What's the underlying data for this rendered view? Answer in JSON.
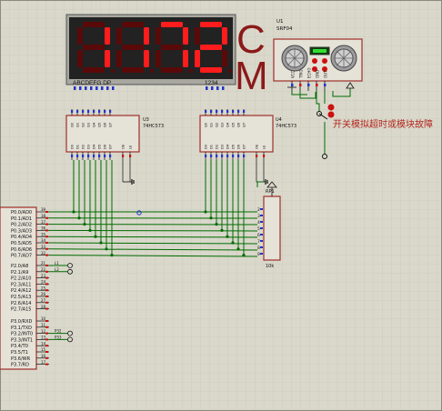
{
  "display": {
    "digits": [
      "1",
      "1",
      "7",
      "2"
    ],
    "seg_label": "ABCDEFG DP",
    "dig_label": "1234",
    "unit_top": "C",
    "unit_bottom": "M"
  },
  "ultrasonic": {
    "ref": "U1",
    "part": "SRF04",
    "pins": [
      "VCC",
      "TRIG",
      "ECHO",
      "GND",
      "OUT"
    ]
  },
  "latch_left": {
    "ref": "U3",
    "part": "74HC573",
    "top_pins": [
      "Q0",
      "Q1",
      "Q2",
      "Q3",
      "Q4",
      "Q5",
      "Q6",
      "Q7"
    ],
    "bottom_pins": [
      "D0",
      "D1",
      "D2",
      "D3",
      "D4",
      "D5",
      "D6",
      "D7"
    ],
    "side_pins": [
      "OE",
      "LE"
    ]
  },
  "latch_right": {
    "ref": "U4",
    "part": "74HC573",
    "top_pins": [
      "Q0",
      "Q1",
      "Q2",
      "Q3",
      "Q4",
      "Q5",
      "Q6",
      "Q7"
    ],
    "bottom_pins": [
      "D0",
      "D1",
      "D2",
      "D3",
      "D4",
      "D5",
      "D6",
      "D7"
    ],
    "side_pins": [
      "OE",
      "LE"
    ]
  },
  "resistor_pack": {
    "ref": "RP1",
    "value": "10k",
    "pins": [
      "2",
      "3",
      "4",
      "5",
      "6",
      "7",
      "8",
      "9"
    ]
  },
  "note": "开关模拟超时或模块故障",
  "mcu": {
    "port0": [
      {
        "name": "P0.0/AD0",
        "pin": "39"
      },
      {
        "name": "P0.1/AD1",
        "pin": "38"
      },
      {
        "name": "P0.2/AD2",
        "pin": "37"
      },
      {
        "name": "P0.3/AD3",
        "pin": "36"
      },
      {
        "name": "P0.4/AD4",
        "pin": "35"
      },
      {
        "name": "P0.5/AD5",
        "pin": "34"
      },
      {
        "name": "P0.6/AD6",
        "pin": "33"
      },
      {
        "name": "P0.7/AD7",
        "pin": "32"
      }
    ],
    "port2": [
      {
        "name": "P2.0/A8",
        "pin": "21"
      },
      {
        "name": "P2.1/A9",
        "pin": "22"
      },
      {
        "name": "P2.2/A10",
        "pin": "23"
      },
      {
        "name": "P2.3/A11",
        "pin": "24"
      },
      {
        "name": "P2.4/A12",
        "pin": "25"
      },
      {
        "name": "P2.5/A13",
        "pin": "26"
      },
      {
        "name": "P2.6/A14",
        "pin": "27"
      },
      {
        "name": "P2.7/A15",
        "pin": "28"
      }
    ],
    "port3": [
      {
        "name": "P3.0/RXD",
        "pin": "10"
      },
      {
        "name": "P3.1/TXD",
        "pin": "11"
      },
      {
        "name": "P3.2/INT0",
        "pin": "12"
      },
      {
        "name": "P3.3/INT1",
        "pin": "13"
      },
      {
        "name": "P3.4/T0",
        "pin": "14"
      },
      {
        "name": "P3.5/T1",
        "pin": "15"
      },
      {
        "name": "P3.6/WR",
        "pin": "16"
      },
      {
        "name": "P3.7/RD",
        "pin": "17"
      }
    ],
    "p2_net_labels": [
      "L1",
      "L2"
    ],
    "p3_net_labels": [
      "P32",
      "P33"
    ]
  },
  "colors": {
    "background": "#d9d8cb",
    "grid": "#c7c6b8",
    "wire": "#006b00",
    "component_body": "#e5e2d8",
    "component_outline": "#a0302a",
    "led_on": "#ff1c1c",
    "led_off": "#5a0909",
    "display_case": "#222222",
    "pin_blue": "#2233cc",
    "pin_red": "#cc1111"
  }
}
